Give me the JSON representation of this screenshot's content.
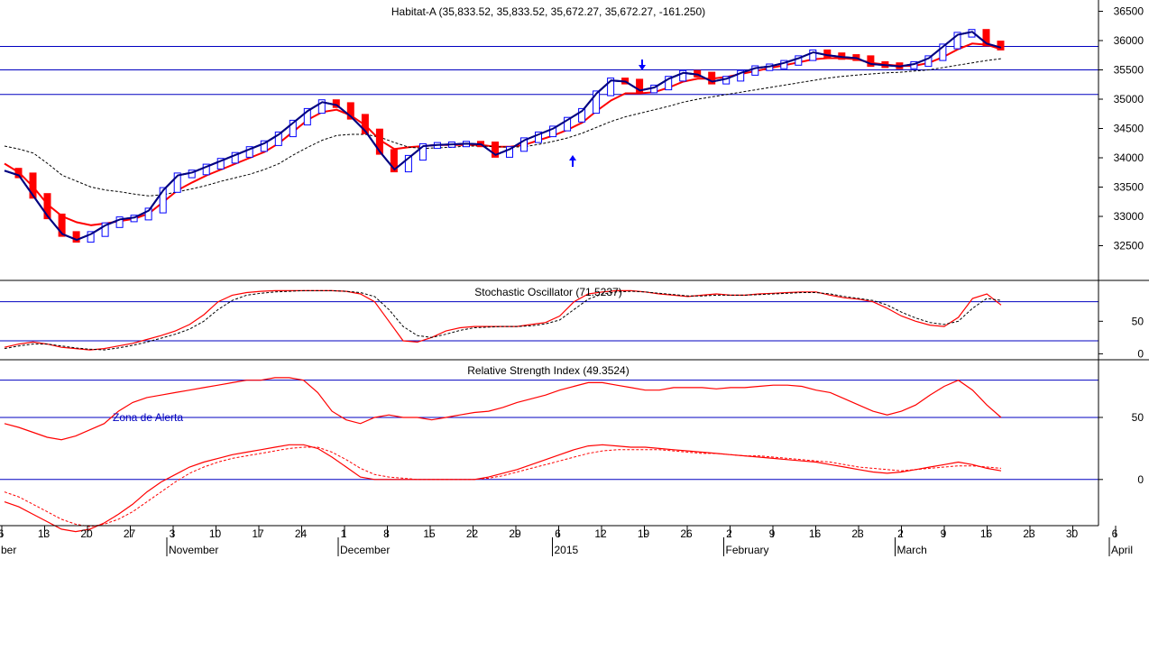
{
  "chart_data": {
    "type": "line",
    "instrument": "Habitat-A",
    "colors": {
      "background": "#ffffff",
      "grid_line": "#0000c0",
      "candle_up_outline": "#0000ff",
      "candle_down_fill": "#ff0000",
      "price_line": "#000080",
      "moving_average": "#ff0000",
      "oscillator_main": "#ff0000",
      "axis": "#000000"
    },
    "price_panel": {
      "title": "Habitat-A (35,833.52, 35,833.52, 35,672.27, 35,672.27, -161.250)",
      "ylim": [
        32000,
        36600
      ],
      "yticks": [
        32500,
        33000,
        33500,
        34000,
        34500,
        35000,
        35500,
        36000,
        36500
      ],
      "hlines": [
        35900,
        35500,
        35080
      ],
      "series": [
        {
          "type": "line",
          "style": "dark-blue",
          "y": [
            33780,
            33700,
            33350,
            33000,
            32700,
            32600,
            32700,
            32850,
            32950,
            32980,
            33100,
            33450,
            33700,
            33750,
            33850,
            33950,
            34050,
            34150,
            34250,
            34400,
            34600,
            34800,
            34950,
            34900,
            34700,
            34450,
            34100,
            33800,
            34000,
            34200,
            34220,
            34230,
            34240,
            34230,
            34050,
            34150,
            34300,
            34400,
            34500,
            34650,
            34800,
            35100,
            35320,
            35300,
            35150,
            35200,
            35350,
            35450,
            35420,
            35300,
            35350,
            35450,
            35530,
            35560,
            35620,
            35700,
            35800,
            35750,
            35720,
            35700,
            35600,
            35580,
            35560,
            35600,
            35700,
            35900,
            36100,
            36150,
            35950,
            35880
          ]
        },
        {
          "type": "line",
          "style": "red",
          "y": [
            33900,
            33750,
            33500,
            33200,
            33000,
            32900,
            32850,
            32880,
            32920,
            32960,
            33050,
            33250,
            33450,
            33580,
            33700,
            33800,
            33900,
            34000,
            34100,
            34250,
            34450,
            34650,
            34780,
            34820,
            34720,
            34550,
            34300,
            34150,
            34180,
            34200,
            34220,
            34220,
            34220,
            34220,
            34190,
            34190,
            34220,
            34300,
            34380,
            34480,
            34600,
            34800,
            34980,
            35100,
            35100,
            35120,
            35200,
            35300,
            35350,
            35350,
            35380,
            35430,
            35480,
            35530,
            35580,
            35630,
            35680,
            35700,
            35700,
            35680,
            35620,
            35590,
            35570,
            35570,
            35620,
            35720,
            35850,
            35950,
            35930,
            35850
          ]
        },
        {
          "type": "line",
          "style": "black-dotted",
          "y": [
            34200,
            34150,
            34080,
            33900,
            33700,
            33600,
            33500,
            33450,
            33420,
            33380,
            33350,
            33370,
            33420,
            33470,
            33530,
            33600,
            33660,
            33720,
            33800,
            33900,
            34050,
            34180,
            34300,
            34380,
            34400,
            34400,
            34350,
            34260,
            34180,
            34160,
            34170,
            34180,
            34200,
            34200,
            34190,
            34180,
            34190,
            34230,
            34280,
            34340,
            34420,
            34520,
            34620,
            34700,
            34760,
            34820,
            34880,
            34950,
            35000,
            35040,
            35080,
            35120,
            35160,
            35200,
            35240,
            35280,
            35320,
            35360,
            35390,
            35410,
            35430,
            35450,
            35460,
            35480,
            35500,
            35540,
            35580,
            35620,
            35660,
            35690
          ]
        }
      ]
    },
    "stochastic_panel": {
      "title": "Stochastic Oscillator (71.5237)",
      "ylim": [
        -5,
        110
      ],
      "yticks": [
        0,
        50
      ],
      "hlines": [
        80,
        20
      ],
      "series": [
        {
          "type": "line",
          "style": "red",
          "y": [
            10,
            15,
            18,
            15,
            10,
            8,
            6,
            8,
            12,
            16,
            22,
            28,
            35,
            45,
            60,
            80,
            90,
            94,
            96,
            97,
            97,
            97,
            97,
            97,
            96,
            92,
            80,
            50,
            20,
            18,
            25,
            35,
            40,
            42,
            42,
            42,
            42,
            45,
            48,
            58,
            80,
            92,
            95,
            97,
            97,
            95,
            92,
            90,
            88,
            90,
            92,
            90,
            90,
            92,
            93,
            94,
            95,
            95,
            90,
            86,
            84,
            80,
            70,
            58,
            50,
            44,
            42,
            56,
            85,
            92,
            75
          ]
        },
        {
          "type": "line",
          "style": "black-dotted",
          "y": [
            8,
            12,
            15,
            15,
            12,
            9,
            7,
            6,
            9,
            13,
            18,
            24,
            30,
            38,
            50,
            68,
            82,
            90,
            93,
            95,
            96,
            97,
            97,
            97,
            96,
            94,
            88,
            68,
            42,
            28,
            25,
            30,
            36,
            40,
            41,
            42,
            42,
            43,
            46,
            52,
            68,
            84,
            92,
            95,
            96,
            95,
            93,
            91,
            89,
            89,
            90,
            90,
            90,
            91,
            92,
            93,
            94,
            94,
            92,
            88,
            85,
            82,
            75,
            64,
            55,
            48,
            45,
            50,
            70,
            85,
            82
          ]
        }
      ]
    },
    "rsi_panel": {
      "title": "Relative Strength Index (49.3524)",
      "annotation": "Zona de Alerta",
      "ylim": [
        -35,
        95
      ],
      "yticks": [
        0,
        50
      ],
      "hlines": [
        80,
        50,
        0
      ],
      "series": [
        {
          "type": "line",
          "style": "red",
          "y": [
            45,
            42,
            38,
            34,
            32,
            35,
            40,
            45,
            55,
            62,
            66,
            68,
            70,
            72,
            74,
            76,
            78,
            80,
            80,
            82,
            82,
            80,
            70,
            55,
            48,
            45,
            50,
            52,
            50,
            50,
            48,
            50,
            52,
            54,
            55,
            58,
            62,
            65,
            68,
            72,
            75,
            78,
            78,
            76,
            74,
            72,
            72,
            74,
            74,
            74,
            73,
            74,
            74,
            75,
            76,
            76,
            75,
            72,
            70,
            65,
            60,
            55,
            52,
            55,
            60,
            68,
            75,
            80,
            72,
            60,
            50
          ]
        },
        {
          "type": "line",
          "style": "red",
          "y": [
            -18,
            -22,
            -28,
            -34,
            -40,
            -42,
            -40,
            -35,
            -28,
            -20,
            -10,
            -2,
            4,
            10,
            14,
            17,
            20,
            22,
            24,
            26,
            28,
            28,
            25,
            18,
            10,
            2,
            0,
            0,
            0,
            0,
            0,
            0,
            0,
            0,
            2,
            5,
            8,
            12,
            16,
            20,
            24,
            27,
            28,
            27,
            26,
            26,
            25,
            24,
            23,
            22,
            21,
            20,
            19,
            18,
            17,
            16,
            15,
            14,
            12,
            10,
            8,
            6,
            5,
            6,
            8,
            10,
            12,
            14,
            12,
            9,
            7
          ]
        },
        {
          "type": "line",
          "style": "red-dotted",
          "y": [
            -10,
            -14,
            -20,
            -26,
            -32,
            -36,
            -38,
            -36,
            -32,
            -26,
            -18,
            -10,
            -2,
            5,
            10,
            14,
            17,
            19,
            21,
            23,
            25,
            26,
            26,
            22,
            16,
            9,
            4,
            2,
            1,
            0,
            0,
            0,
            0,
            0,
            1,
            3,
            6,
            9,
            12,
            15,
            18,
            21,
            23,
            24,
            24,
            24,
            24,
            23,
            22,
            21,
            21,
            20,
            19,
            19,
            18,
            17,
            16,
            15,
            14,
            12,
            10,
            9,
            8,
            7,
            8,
            9,
            10,
            11,
            11,
            10,
            9
          ]
        }
      ]
    },
    "x_axis": {
      "tick_labels": [
        "6",
        "13",
        "20",
        "27",
        "3",
        "10",
        "17",
        "24",
        "1",
        "8",
        "15",
        "22",
        "29",
        "6",
        "12",
        "19",
        "26",
        "2",
        "9",
        "16",
        "23",
        "2",
        "9",
        "16",
        "23",
        "30",
        "6"
      ],
      "month_labels": [
        "ber",
        "November",
        "December",
        "2015",
        "February",
        "March",
        "April"
      ]
    }
  }
}
